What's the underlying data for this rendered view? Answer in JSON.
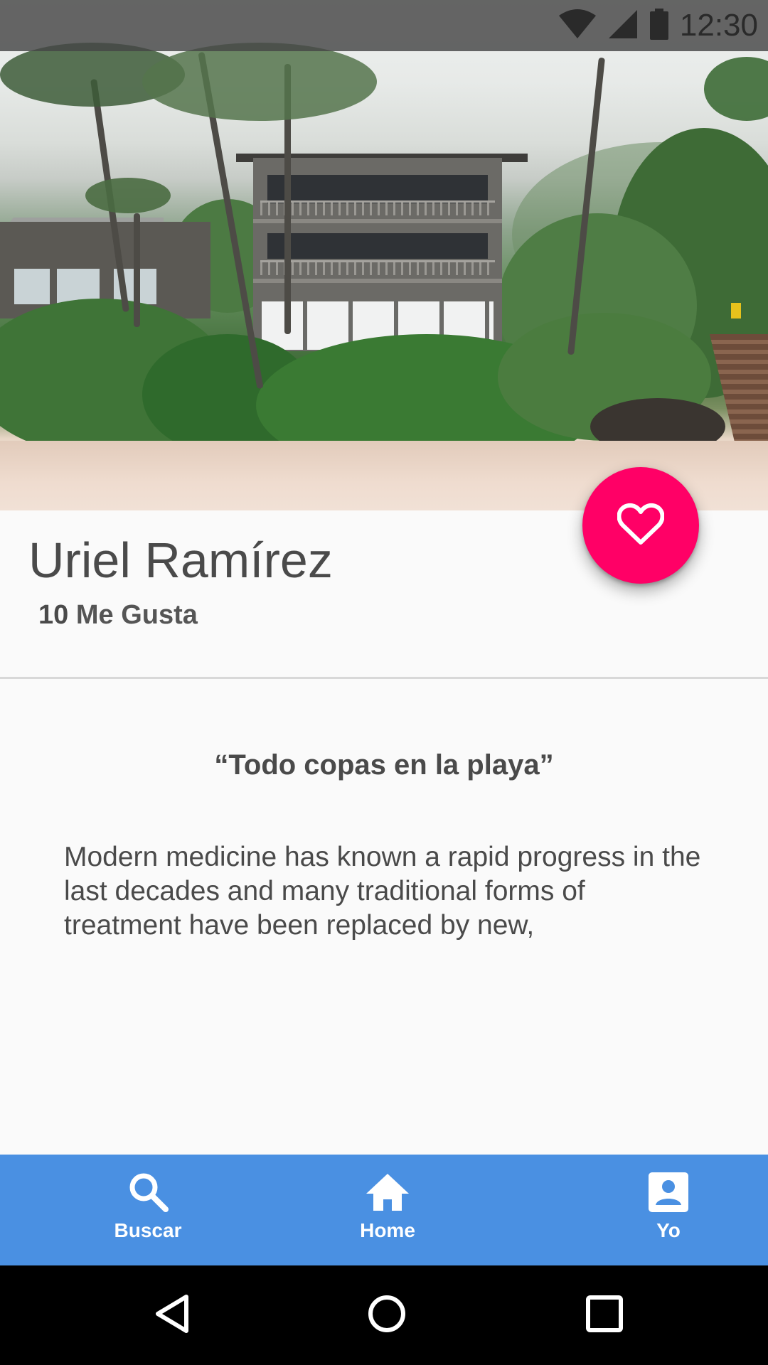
{
  "status_bar": {
    "time": "12:30",
    "icons": [
      "wifi-icon",
      "signal-icon",
      "battery-icon"
    ]
  },
  "hero": {
    "image": "beach-house-photo"
  },
  "fab": {
    "icon": "heart-outline-icon",
    "color": "#ff0066"
  },
  "profile": {
    "name": "Uriel Ramírez",
    "likes_count": "10",
    "likes_label": "Me Gusta"
  },
  "content": {
    "quote": "“Todo copas en la playa”",
    "body": "Modern medicine has known a rapid progress in the last decades and many traditional forms of treatment have been replaced by new,"
  },
  "bottom_nav": {
    "background": "#4a90e2",
    "items": [
      {
        "label": "Buscar",
        "icon": "search-icon"
      },
      {
        "label": "Home",
        "icon": "home-icon"
      },
      {
        "label": "Yo",
        "icon": "account-box-icon"
      }
    ]
  },
  "system_nav": {
    "buttons": [
      "back-icon",
      "home-circle-icon",
      "recents-icon"
    ]
  }
}
